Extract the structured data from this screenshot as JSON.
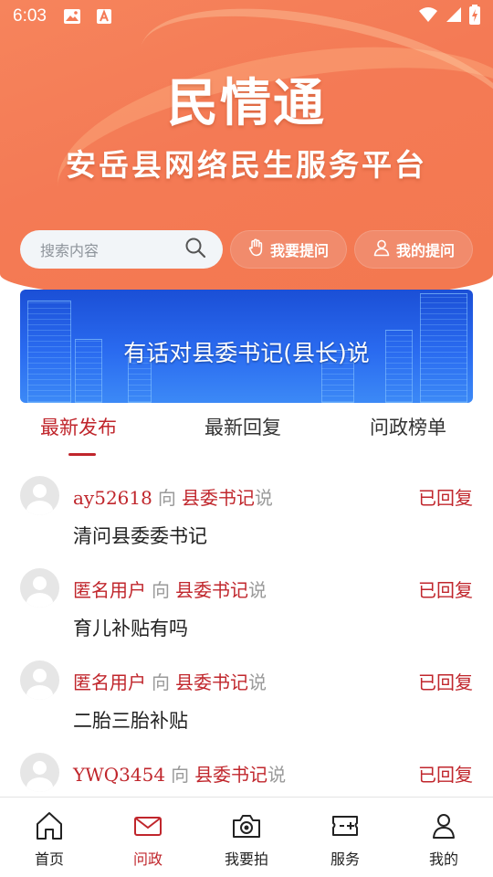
{
  "status_bar": {
    "time": "6:03"
  },
  "header": {
    "title": "民情通",
    "subtitle": "安岳县网络民生服务平台"
  },
  "search": {
    "placeholder": "搜索内容"
  },
  "actions": {
    "ask_label": "我要提问",
    "my_questions_label": "我的提问"
  },
  "banner": {
    "text": "有话对县委书记(县长)说"
  },
  "tabs": [
    {
      "label": "最新发布",
      "active": true
    },
    {
      "label": "最新回复",
      "active": false
    },
    {
      "label": "问政榜单",
      "active": false
    }
  ],
  "posts": [
    {
      "user": "ay52618",
      "to": "向",
      "target": "县委书记",
      "said": "说",
      "status": "已回复",
      "content": "清问县委委书记"
    },
    {
      "user": "匿名用户",
      "to": "向",
      "target": "县委书记",
      "said": "说",
      "status": "已回复",
      "content": "育儿补贴有吗"
    },
    {
      "user": "匿名用户",
      "to": "向",
      "target": "县委书记",
      "said": "说",
      "status": "已回复",
      "content": "二胎三胎补贴"
    },
    {
      "user": "YWQ3454",
      "to": "向",
      "target": "县委书记",
      "said": "说",
      "status": "已回复",
      "content": ""
    }
  ],
  "bottom_nav": [
    {
      "label": "首页",
      "icon": "home-icon",
      "active": false
    },
    {
      "label": "问政",
      "icon": "mail-icon",
      "active": true
    },
    {
      "label": "我要拍",
      "icon": "camera-icon",
      "active": false
    },
    {
      "label": "服务",
      "icon": "service-ticket-icon",
      "active": false
    },
    {
      "label": "我的",
      "icon": "person-icon",
      "active": false
    }
  ],
  "colors": {
    "accent": "#c0262c",
    "header": "#f47a55",
    "banner": "#2a6bf0"
  }
}
